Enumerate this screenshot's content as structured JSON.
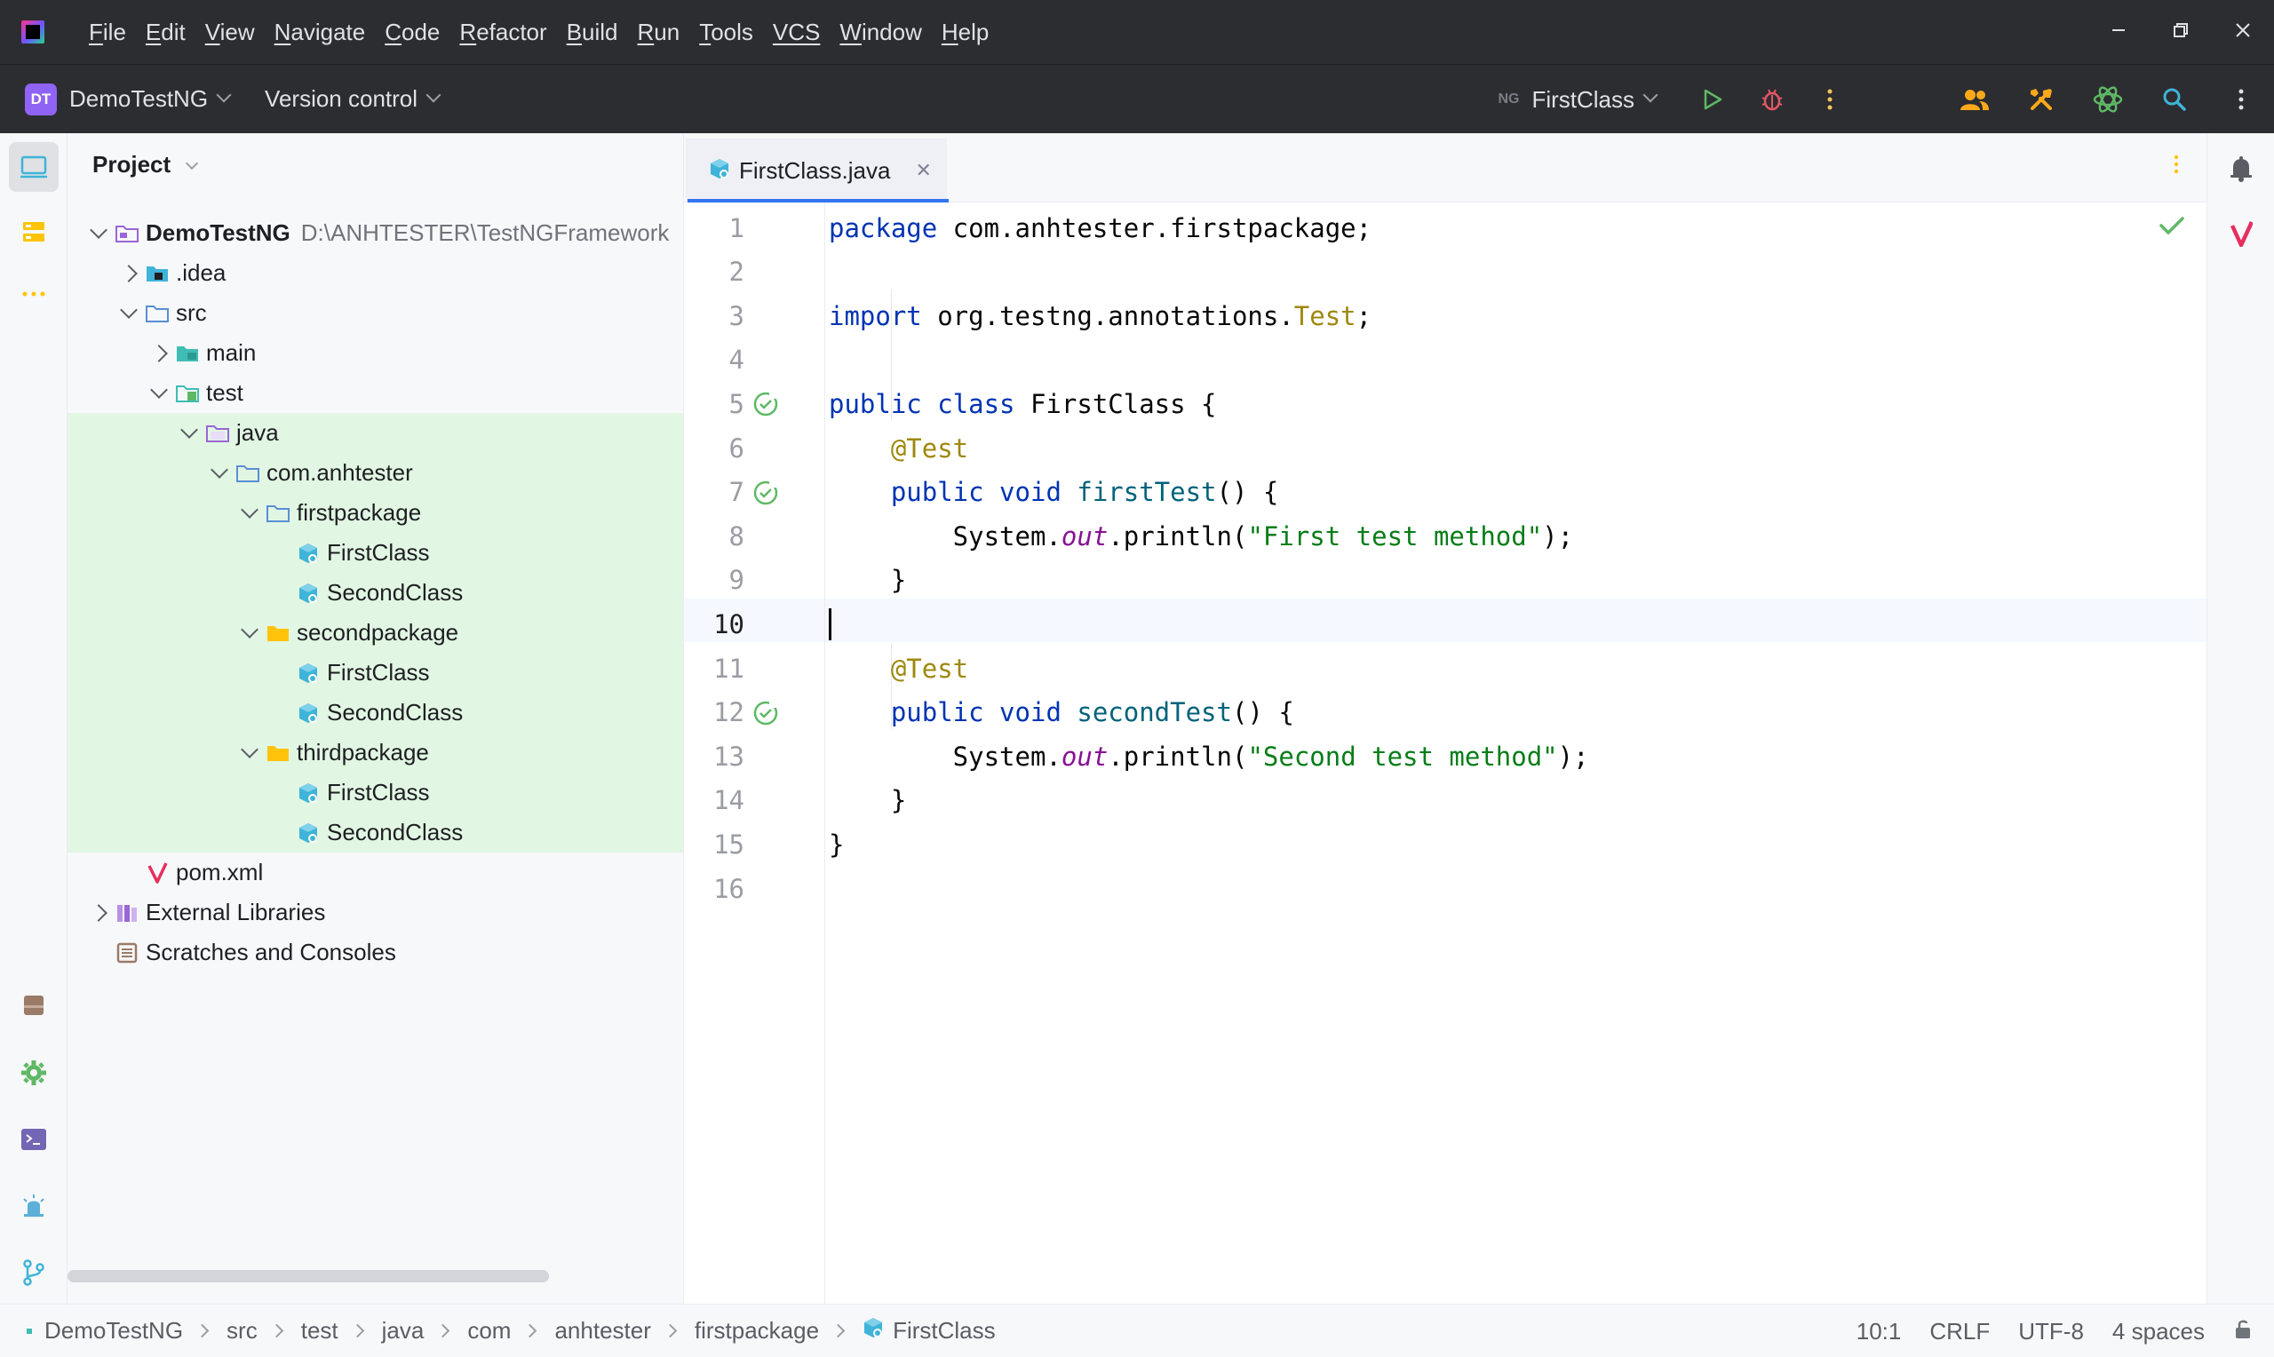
{
  "menubar": {
    "items": [
      {
        "u": "F",
        "rest": "ile"
      },
      {
        "u": "E",
        "rest": "dit"
      },
      {
        "u": "V",
        "rest": "iew"
      },
      {
        "u": "N",
        "rest": "avigate"
      },
      {
        "u": "C",
        "rest": "ode"
      },
      {
        "u": "R",
        "rest": "efactor"
      },
      {
        "u": "B",
        "rest": "uild"
      },
      {
        "u": "R",
        "rest": "un",
        "pre": ""
      },
      {
        "u": "T",
        "rest": "ools"
      },
      {
        "u": "VCS",
        "rest": ""
      },
      {
        "u": "W",
        "rest": "indow"
      },
      {
        "u": "H",
        "rest": "elp"
      }
    ]
  },
  "toolbar": {
    "project_badge": "DT",
    "project_name": "DemoTestNG",
    "vcs_label": "Version control",
    "run_config": "FirstClass",
    "ng_badge": "NG"
  },
  "project_panel": {
    "title": "Project",
    "root_name": "DemoTestNG",
    "root_path": "D:\\ANHTESTER\\TestNGFramework",
    "tree": [
      {
        "label": "DemoTestNG",
        "depth": 0,
        "arrow": "down",
        "icon": "module-folder-icon"
      },
      {
        "label": ".idea",
        "depth": 1,
        "arrow": "right",
        "icon": "idea-folder-icon"
      },
      {
        "label": "src",
        "depth": 1,
        "arrow": "down",
        "icon": "folder-icon"
      },
      {
        "label": "main",
        "depth": 2,
        "arrow": "right",
        "icon": "source-folder-icon"
      },
      {
        "label": "test",
        "depth": 2,
        "arrow": "down",
        "icon": "test-folder-icon"
      },
      {
        "label": "java",
        "depth": 3,
        "arrow": "down",
        "icon": "test-root-icon",
        "hl": true
      },
      {
        "label": "com.anhtester",
        "depth": 4,
        "arrow": "down",
        "icon": "package-icon",
        "hl": true
      },
      {
        "label": "firstpackage",
        "depth": 5,
        "arrow": "down",
        "icon": "package-icon",
        "hl": true
      },
      {
        "label": "FirstClass",
        "depth": 6,
        "arrow": "",
        "icon": "java-class-icon",
        "hl": true
      },
      {
        "label": "SecondClass",
        "depth": 6,
        "arrow": "",
        "icon": "java-class-icon",
        "hl": true
      },
      {
        "label": "secondpackage",
        "depth": 5,
        "arrow": "down",
        "icon": "yellow-folder-icon",
        "hl": true
      },
      {
        "label": "FirstClass",
        "depth": 6,
        "arrow": "",
        "icon": "java-class-icon",
        "hl": true
      },
      {
        "label": "SecondClass",
        "depth": 6,
        "arrow": "",
        "icon": "java-class-icon",
        "hl": true
      },
      {
        "label": "thirdpackage",
        "depth": 5,
        "arrow": "down",
        "icon": "yellow-folder-icon",
        "hl": true
      },
      {
        "label": "FirstClass",
        "depth": 6,
        "arrow": "",
        "icon": "java-class-icon",
        "hl": true
      },
      {
        "label": "SecondClass",
        "depth": 6,
        "arrow": "",
        "icon": "java-class-icon",
        "hl": true
      },
      {
        "label": "pom.xml",
        "depth": 1,
        "arrow": "",
        "icon": "maven-icon"
      },
      {
        "label": "External Libraries",
        "depth": 0,
        "arrow": "right",
        "icon": "libraries-icon"
      },
      {
        "label": "Scratches and Consoles",
        "depth": 0,
        "arrow": "",
        "icon": "scratches-icon"
      }
    ]
  },
  "editor": {
    "tab_label": "FirstClass.java",
    "current_line": 10,
    "lines": [
      {
        "n": "1",
        "tokens": [
          [
            "kw",
            "package"
          ],
          [
            "",
            ""
          ],
          [
            "",
            " com.anhtester.firstpackage;"
          ]
        ]
      },
      {
        "n": "2",
        "tokens": []
      },
      {
        "n": "3",
        "tokens": [
          [
            "kw",
            "import"
          ],
          [
            "",
            " org.testng.annotations."
          ],
          [
            "ann",
            "Test"
          ],
          [
            "",
            ";"
          ]
        ]
      },
      {
        "n": "4",
        "tokens": []
      },
      {
        "n": "5",
        "gutter": "run-test",
        "tokens": [
          [
            "kw",
            "public class"
          ],
          [
            "",
            " FirstClass {"
          ]
        ]
      },
      {
        "n": "6",
        "tokens": [
          [
            "",
            "    "
          ],
          [
            "ann",
            "@Test"
          ]
        ]
      },
      {
        "n": "7",
        "gutter": "run-test",
        "tokens": [
          [
            "",
            "    "
          ],
          [
            "kw",
            "public void"
          ],
          [
            "",
            " "
          ],
          [
            "fn",
            "firstTest"
          ],
          [
            "",
            "() {"
          ]
        ]
      },
      {
        "n": "8",
        "tokens": [
          [
            "",
            "        System."
          ],
          [
            "fld",
            "out"
          ],
          [
            "",
            ".println("
          ],
          [
            "str",
            "\"First test method\""
          ],
          [
            "",
            ");"
          ]
        ]
      },
      {
        "n": "9",
        "tokens": [
          [
            "",
            "    }"
          ]
        ]
      },
      {
        "n": "10",
        "cursor": true,
        "tokens": []
      },
      {
        "n": "11",
        "tokens": [
          [
            "",
            "    "
          ],
          [
            "ann",
            "@Test"
          ]
        ]
      },
      {
        "n": "12",
        "gutter": "run-test",
        "tokens": [
          [
            "",
            "    "
          ],
          [
            "kw",
            "public void"
          ],
          [
            "",
            " "
          ],
          [
            "fn",
            "secondTest"
          ],
          [
            "",
            "() {"
          ]
        ]
      },
      {
        "n": "13",
        "tokens": [
          [
            "",
            "        System."
          ],
          [
            "fld",
            "out"
          ],
          [
            "",
            ".println("
          ],
          [
            "str",
            "\"Second test method\""
          ],
          [
            "",
            ");"
          ]
        ]
      },
      {
        "n": "14",
        "tokens": [
          [
            "",
            "    }"
          ]
        ]
      },
      {
        "n": "15",
        "tokens": [
          [
            "",
            "}"
          ]
        ]
      },
      {
        "n": "16",
        "tokens": []
      }
    ]
  },
  "status": {
    "breadcrumbs": [
      "DemoTestNG",
      "src",
      "test",
      "java",
      "com",
      "anhtester",
      "firstpackage",
      "FirstClass"
    ],
    "position": "10:1",
    "line_sep": "CRLF",
    "encoding": "UTF-8",
    "indent": "4 spaces"
  },
  "colors": {
    "accent": "#3574f0",
    "run_green": "#5fb865",
    "debug_red": "#e55765",
    "tree_highlight": "#e2f6e4"
  }
}
